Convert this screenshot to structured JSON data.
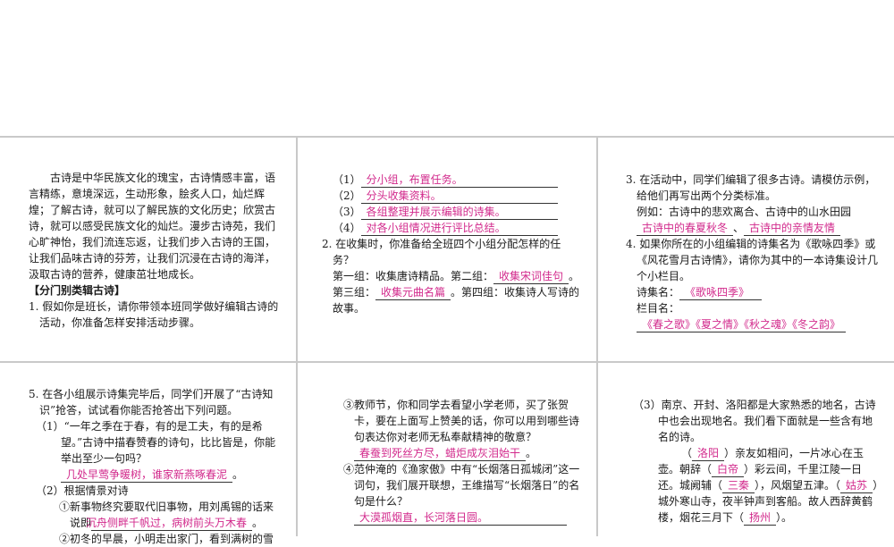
{
  "p1": {
    "intro": "古诗是中华民族文化的瑰宝，古诗情感丰富，语言精练，意境深远，生动形象，脍炙人口，灿烂辉煌；了解古诗，就可以了解民族的文化历史；欣赏古诗，就可以感受民族文化的灿烂。漫步古诗苑，我们心旷神怡，我们流连忘返，让我们步入古诗的王国，让我们品味古诗的芬芳，让我们沉浸在古诗的海洋，汲取古诗的营养，健康茁壮地成长。",
    "section": "【分门别类辑古诗】",
    "q1": "1. 假如你是班长，请你带领本班同学做好编辑古诗的活动，你准备怎样安排活动步骤。"
  },
  "p2": {
    "steps": [
      {
        "n": "（1）",
        "a": "分小组，布置任务。"
      },
      {
        "n": "（2）",
        "a": "分头收集资料。"
      },
      {
        "n": "（3）",
        "a": "各组整理并展示编辑的诗集。"
      },
      {
        "n": "（4）",
        "a": "对各小组情况进行评比总结。"
      }
    ],
    "q2": "2. 在收集时，你准备给全班四个小组分配怎样的任务？",
    "g1": "第一组：收集唐诗精品。第二组：",
    "g2ans": "收集宋词佳句",
    "g3": "。第三组：",
    "g3ans": "收集元曲名篇",
    "g4": "。第四组：收集诗人写诗的故事。"
  },
  "p3": {
    "q3": "3. 在活动中，同学们编辑了很多古诗。请模仿示例，给他们再写出两个分类标准。",
    "example": "例如：古诗中的悲欢离合、古诗中的山水田园",
    "a1": "古诗中的春夏秋冬",
    "sep": "、",
    "a2": "古诗中的亲情友情",
    "q4": "4. 如果你所在的小组编辑的诗集名为《歌咏四季》或《风花雪月古诗情》，请你为其中的一本诗集设计几个小栏目。",
    "name_label": "诗集名：",
    "name_ans": "《歌咏四季》",
    "col_label": "栏目名：",
    "col_ans": "《春之歌》《夏之情》《秋之魂》《冬之韵》"
  },
  "p4": {
    "q5": "5. 在各小组展示诗集完毕后，同学们开展了“古诗知识”抢答，试试看你能否抢答出下列问题。",
    "s1": "（1）“一年之季在于春，有的是工夫，有的是希望。”古诗中描春赞春的诗句，比比皆是，你能举出至少一句吗？",
    "s1ans": "几处早莺争暖树，谁家新燕啄春泥",
    "s1end": "。",
    "s2": "（2）根据情景对诗",
    "c1": "①新事物终究要取代旧事物，用刘禹锡的话来说即",
    "c1ans": "沉舟侧畔千帆过，病树前头万木春",
    "c1end": "。",
    "c2": "②初冬的早晨，小明走出家门，看到满树的雪"
  },
  "p5": {
    "c3": "③教师节，你和同学去看望小学老师，买了张贺卡，要在上面写上赞美的话，你可以用到哪些诗句表达你对老师无私奉献精神的敬意？",
    "c3ans": "春蚕到死丝方尽，蜡炬成灰泪始干",
    "c3end": "。",
    "c4": "④范仲淹的《渔家傲》中有“长烟落日孤城闭”这一词句，我们展开联想，王维描写“长烟落日”的名句是什么？",
    "c4ans": "大漠孤烟直，长河落日圆。"
  },
  "p6": {
    "s3": "（3）南京、开封、洛阳都是大家熟悉的地名，古诗中也会出现地名。我们看下面就是一些含有地名的诗。",
    "l1a": "（",
    "l1ans": "洛阳",
    "l1b": "）亲友如相问，一片冰心在玉壶。朝辞（",
    "l2ans": "白帝",
    "l2b": "）彩云间，千里江陵一日还。城阙辅（",
    "l3ans": "三秦",
    "l3b": "），风烟望五津。（",
    "l4ans": "姑苏",
    "l4b": "）城外寒山寺，夜半钟声到客船。故人西辞黄鹤楼，烟花三月下（",
    "l5ans": "扬州",
    "l5b": "）。"
  }
}
